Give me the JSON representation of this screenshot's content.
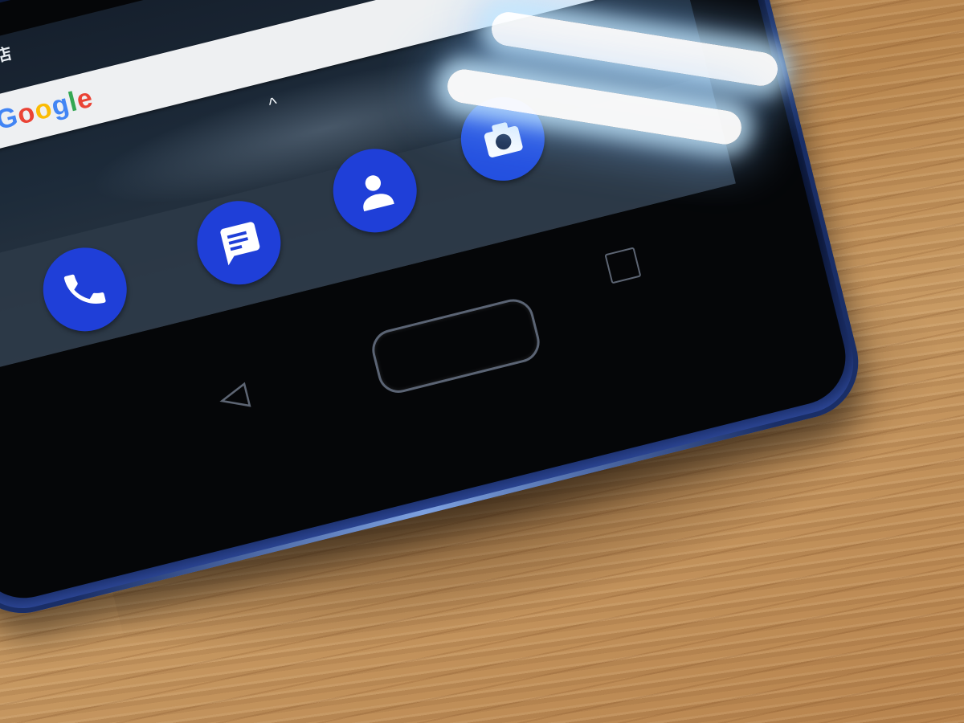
{
  "screen": {
    "top_label": "Play 商店",
    "search": {
      "logo_letters": [
        "G",
        "o",
        "o",
        "g",
        "l",
        "e"
      ]
    },
    "drawer_chevron": "^"
  },
  "dock": {
    "apps": [
      {
        "name": "phone",
        "icon": "phone-handset-icon",
        "color": "#1f3fd8"
      },
      {
        "name": "messages",
        "icon": "message-bubble-icon",
        "color": "#1f3fd8"
      },
      {
        "name": "contacts",
        "icon": "person-icon",
        "color": "#1f3fd8"
      },
      {
        "name": "camera",
        "icon": "camera-icon",
        "color": "#2450e0"
      }
    ]
  },
  "hardware": {
    "back_key": "back-triangle-icon",
    "recents_key": "recents-square-icon",
    "fingerprint": "fingerprint-home-button"
  },
  "colors": {
    "app_accent": "#1f3fd8",
    "phone_body": "#0d1a3d",
    "table_wood": "#c99a66"
  }
}
